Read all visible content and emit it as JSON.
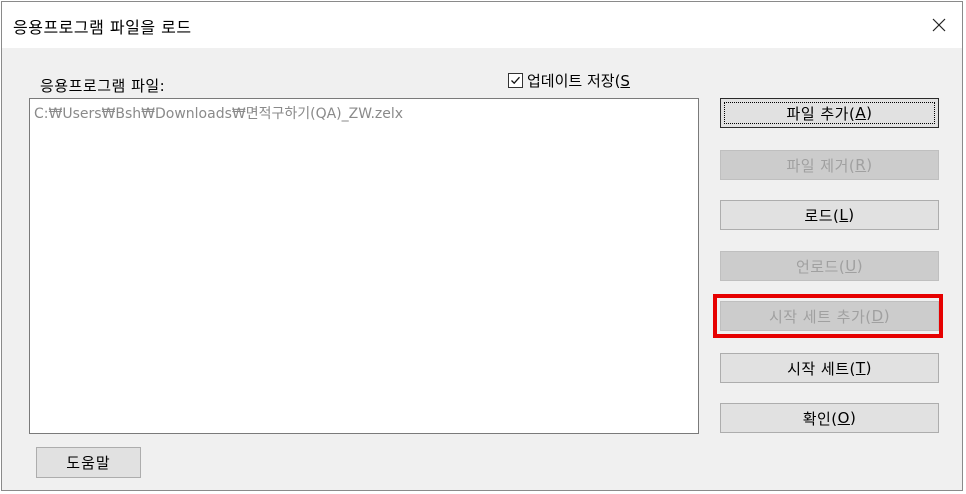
{
  "window": {
    "title": "응용프로그램 파일을 로드",
    "close_icon": "close-icon"
  },
  "files_label": "응용프로그램 파일:",
  "update_save": {
    "label": "업데이트 저장(",
    "mnemonic": "S",
    "checked": true
  },
  "file_list": {
    "items": [
      "C:₩Users₩Bsh₩Downloads₩면적구하기(QA)_ZW.zelx"
    ]
  },
  "buttons": {
    "add_file": {
      "label": "파일 추가(",
      "mnemonic": "A",
      "suffix": ")"
    },
    "remove_file": {
      "label": "파일 제거(",
      "mnemonic": "R",
      "suffix": ")"
    },
    "load": {
      "label": "로드(",
      "mnemonic": "L",
      "suffix": ")"
    },
    "unload": {
      "label": "언로드(",
      "mnemonic": "U",
      "suffix": ")"
    },
    "add_startup_suite": {
      "label": "시작 세트 추가(",
      "mnemonic": "D",
      "suffix": ")"
    },
    "startup_suite": {
      "label": "시작 세트(",
      "mnemonic": "T",
      "suffix": ")"
    },
    "ok": {
      "label": "확인(",
      "mnemonic": "O",
      "suffix": ")"
    },
    "help": {
      "label": "도움말"
    }
  },
  "colors": {
    "highlight": "#e60000",
    "disabled_text": "#a0a0a0",
    "path_text": "#8a8a8a"
  }
}
